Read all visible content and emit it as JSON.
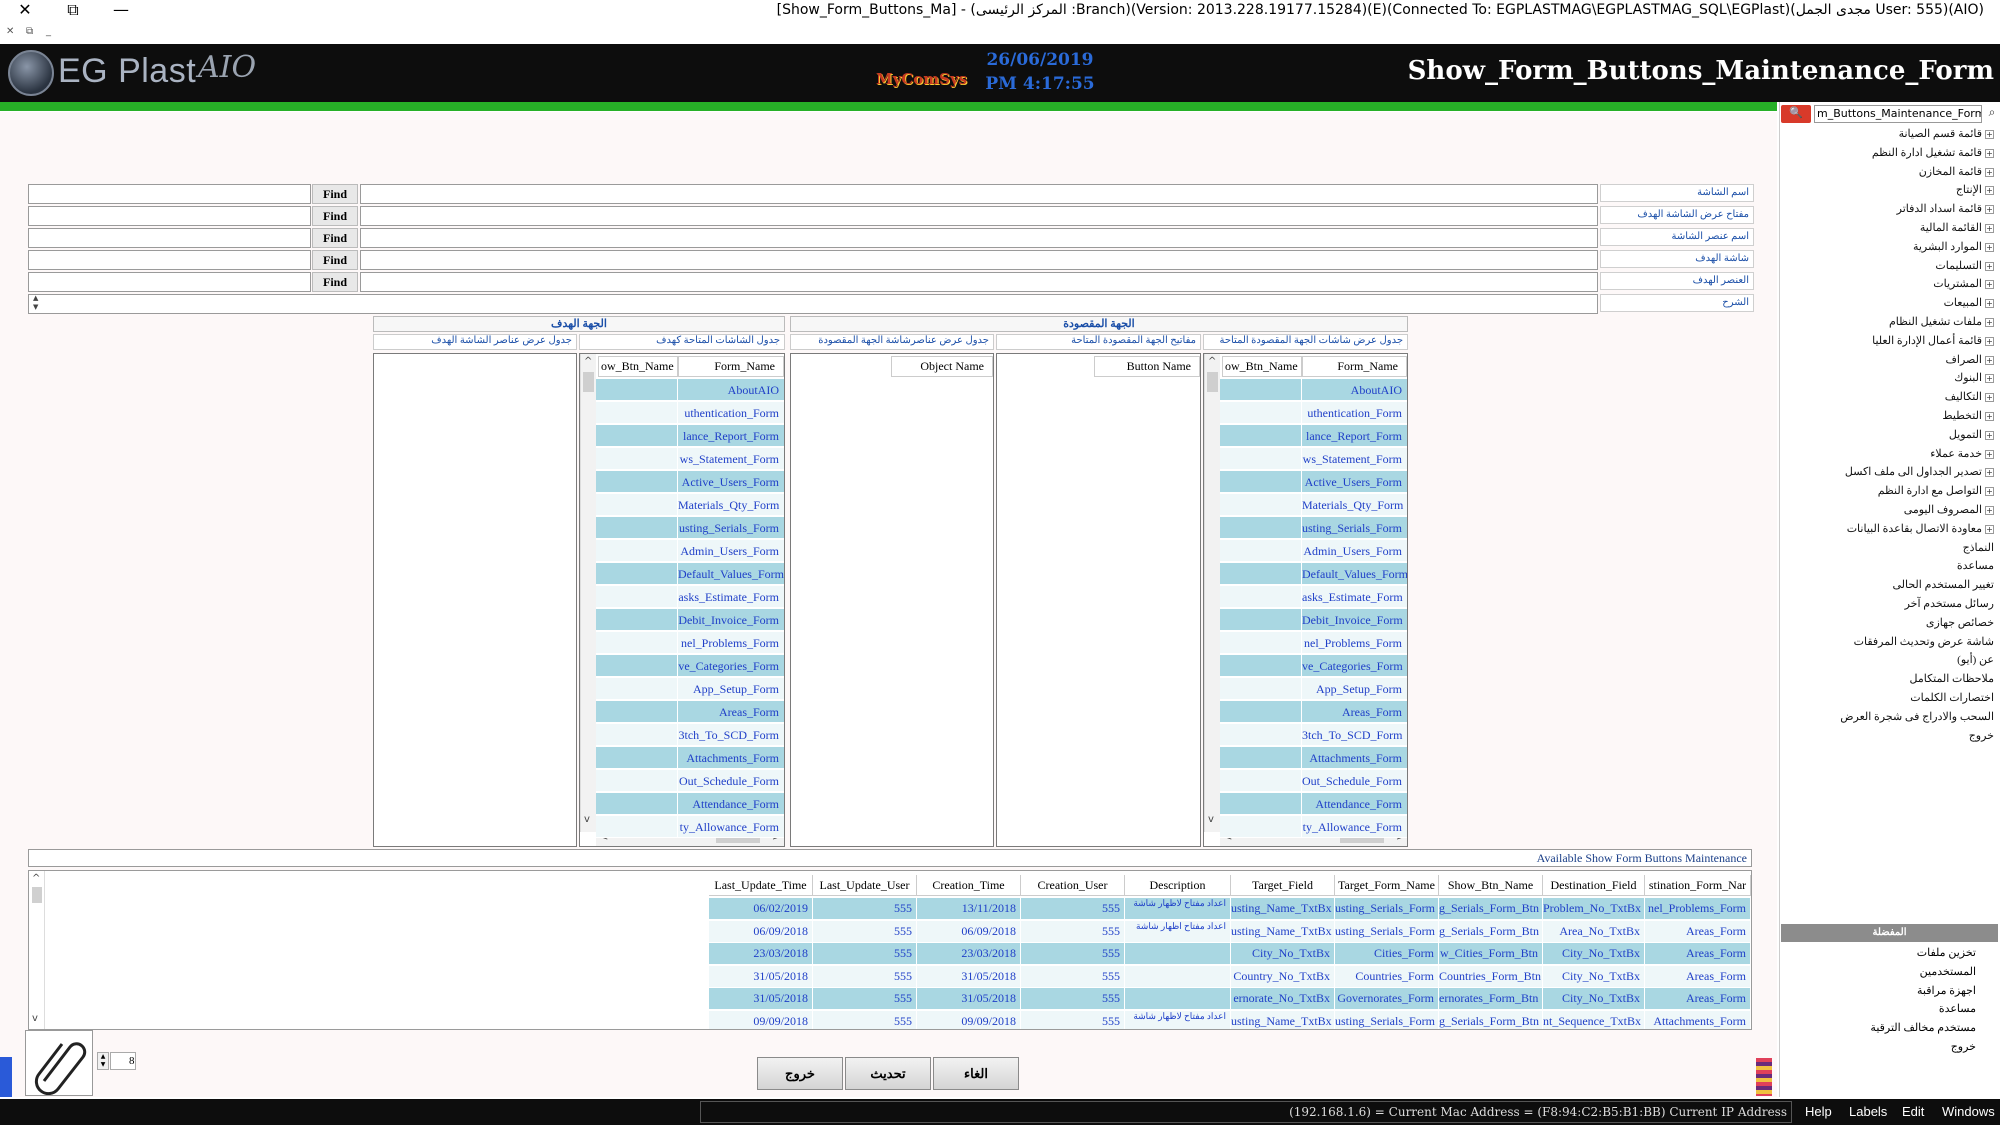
{
  "window": {
    "title": "[Show_Form_Buttons_Ma] - (المركز الرئيسى :Branch)(Version: 2013.228.19177.15284)(E)(Connected To: EGPLASTMAG\\EGPLASTMAG_SQL\\EGPlast)(مجدى الجمل User: 555)(AIO)",
    "close": "✕",
    "restore": "⧉",
    "minimize": "—",
    "mini_close": "✕",
    "mini_restore": "⧉",
    "mini_min": "_"
  },
  "header": {
    "logo_text": "EG Plast",
    "logo_sig": "AIO",
    "mycomsys": "MyComSys",
    "date": "26/06/2019",
    "time": "PM 4:17:55",
    "form_title": "Show_Form_Buttons_Maintenance_Form"
  },
  "fields": [
    {
      "label": "اسم الشاشة",
      "find": "Find"
    },
    {
      "label": "مفتاح عرض الشاشة الهدف",
      "find": "Find"
    },
    {
      "label": "اسم عنصر الشاشة",
      "find": "Find"
    },
    {
      "label": "شاشة الهدف",
      "find": "Find"
    },
    {
      "label": "العنصر الهدف",
      "find": "Find"
    },
    {
      "label": "الشرح"
    }
  ],
  "target_group": {
    "title": "الجهة الهدف",
    "sub_left": "جدول عرض عناصر الشاشة الهدف",
    "sub_right": "جدول الشاشات المتاحة كهدف",
    "col_btn": "ow_Btn_Name",
    "col_form": "Form_Name"
  },
  "source_group": {
    "title": "الجهة المقصودة",
    "sub_left": "جدول عرض عناصرشاشة الجهة المقصودة",
    "sub_mid": "مفاتيح الجهة المقصودة المتاحة",
    "sub_right": "جدول عرض شاشات الجهة المقصودة المتاحة",
    "col_object": "Object Name",
    "col_button": "Button Name",
    "col_btn": "ow_Btn_Name",
    "col_form": "Form_Name"
  },
  "forms": [
    "AboutAIO",
    "uthentication_Form",
    "lance_Report_Form",
    "ws_Statement_Form",
    "Active_Users_Form",
    "Materials_Qty_Form",
    "usting_Serials_Form",
    "Admin_Users_Form",
    "Default_Values_Form",
    "asks_Estimate_Form",
    "Debit_Invoice_Form",
    "nel_Problems_Form",
    "ve_Categories_Form",
    "App_Setup_Form",
    "Areas_Form",
    "3tch_To_SCD_Form",
    "Attachments_Form",
    "Out_Schedule_Form",
    "Attendance_Form",
    "ty_Allowance_Form"
  ],
  "bottom_table": {
    "title": "Available Show Form Buttons Maintenance",
    "columns": [
      "stination_Form_Nar",
      "Destination_Field",
      "Show_Btn_Name",
      "Target_Form_Name",
      "Target_Field",
      "Description",
      "Creation_User",
      "Creation_Time",
      "Last_Update_User",
      "Last_Update_Time"
    ],
    "rows": [
      [
        "nel_Problems_Form",
        "Problem_No_TxtBx",
        "g_Serials_Form_Btn",
        "usting_Serials_Form",
        "usting_Name_TxtBx",
        "اعداد مفتاح لاظهار شاشة",
        "555",
        "13/11/2018",
        "555",
        "06/02/2019"
      ],
      [
        "Areas_Form",
        "Area_No_TxtBx",
        "g_Serials_Form_Btn",
        "usting_Serials_Form",
        "usting_Name_TxtBx",
        "اعداد مفتاح اظهار شاشة",
        "555",
        "06/09/2018",
        "555",
        "06/09/2018"
      ],
      [
        "Areas_Form",
        "City_No_TxtBx",
        "w_Cities_Form_Btn",
        "Cities_Form",
        "City_No_TxtBx",
        "",
        "555",
        "23/03/2018",
        "555",
        "23/03/2018"
      ],
      [
        "Areas_Form",
        "City_No_TxtBx",
        "Countries_Form_Btn",
        "Countries_Form",
        "Country_No_TxtBx",
        "",
        "555",
        "31/05/2018",
        "555",
        "31/05/2018"
      ],
      [
        "Areas_Form",
        "City_No_TxtBx",
        "ernorates_Form_Btn",
        "Governorates_Form",
        "ernorate_No_TxtBx",
        "",
        "555",
        "31/05/2018",
        "555",
        "31/05/2018"
      ],
      [
        "Attachments_Form",
        "nt_Sequence_TxtBx",
        "g_Serials_Form_Btn",
        "usting_Serials_Form",
        "usting_Name_TxtBx",
        "اعداد مفتاح لاظهار شاشة",
        "555",
        "09/09/2018",
        "555",
        "09/09/2018"
      ]
    ]
  },
  "footer": {
    "counter_value": "8",
    "btn_exit": "خروج",
    "btn_update": "تحديث",
    "btn_cancel": "الغاء"
  },
  "sidebar": {
    "search_value": "m_Buttons_Maintenance_Form",
    "search_btn": "🔍",
    "search_icon": "⌕",
    "items": [
      "قائمة قسم الصيانة",
      "قائمة تشغيل ادارة النظم",
      "قائمة المخازن",
      "الإنتاج",
      "قائمة اسداد الدفاتر",
      "القائمة المالية",
      "الموارد البشرية",
      "التسليمات",
      "المشتريات",
      "المبيعات",
      "ملفات تشغيل النظام",
      "قائمة أعمال الإدارة العليا",
      "الصراف",
      "البنوك",
      "التكاليف",
      "التخطيط",
      "التمويل",
      "خدمة عملاء",
      "تصدير الجداول الى ملف اكسل",
      "التواصل مع ادارة النظم",
      "المصروف اليومى",
      "معاودة الاتصال بقاعدة البيانات",
      "النماذج",
      "مساعدة",
      "تغيير المستخدم الحالى",
      "رسائل مستخدم آخر",
      "خصائص جهازى",
      "شاشة عرض وتحديث المرفقات",
      "عن (أيو)",
      "ملاحظات المتكامل",
      "اختصارات الكلمات",
      "السحب والادراج فى شجرة العرض",
      "خروج"
    ],
    "divider": "المفضلة",
    "fav_items": [
      "تخزين ملفات",
      "المستخدمين",
      "اجهزة مراقبة",
      "مساعدة",
      "مستخدم مخالف الترقية",
      "خروج"
    ]
  },
  "statusbar": {
    "ip_text": "(192.168.1.6) = Current Mac Address = (F8:94:C2:B5:B1:BB) Current IP Address",
    "menus": [
      "Help",
      "Labels",
      "Edit",
      "Windows"
    ]
  },
  "colors": {
    "accent_green": "#27b027",
    "header_bg": "#0d0d0d",
    "row_blue": "#a9d7e2",
    "link_blue": "#1f3fc8"
  }
}
